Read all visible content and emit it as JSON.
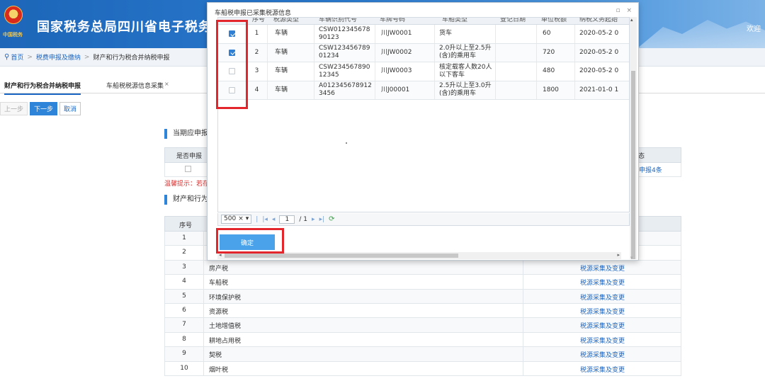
{
  "header": {
    "emblem_caption": "中国税务",
    "site_title": "国家税务总局四川省电子税务局",
    "welcome": "欢迎"
  },
  "breadcrumb": {
    "home": "首页",
    "level1": "税费申报及缴纳",
    "level2": "财产和行为税合并纳税申报",
    "separator": ">"
  },
  "tabs": [
    {
      "label": "财产和行为税合并纳税申报",
      "close": ""
    },
    {
      "label": "车船税税源信息采集",
      "close": "×"
    }
  ],
  "steps": {
    "prev": "上一步",
    "next": "下一步",
    "cancel": "取消"
  },
  "section1": {
    "title": "当期应申报",
    "col_declare": "是否申报",
    "col_status": "态",
    "row_count_link": "未申报4条",
    "tip": "温馨提示：若存"
  },
  "section2": {
    "title": "财产和行为",
    "col_no": "序号",
    "rows": [
      {
        "no": "1",
        "name": "",
        "action": ""
      },
      {
        "no": "2",
        "name": "",
        "action": ""
      },
      {
        "no": "3",
        "name": "房产税",
        "action": "税源采集及变更"
      },
      {
        "no": "4",
        "name": "车船税",
        "action": "税源采集及变更"
      },
      {
        "no": "5",
        "name": "环境保护税",
        "action": "税源采集及变更"
      },
      {
        "no": "6",
        "name": "资源税",
        "action": "税源采集及变更"
      },
      {
        "no": "7",
        "name": "土地增值税",
        "action": "税源采集及变更"
      },
      {
        "no": "8",
        "name": "耕地占用税",
        "action": "税源采集及变更"
      },
      {
        "no": "9",
        "name": "契税",
        "action": "税源采集及变更"
      },
      {
        "no": "10",
        "name": "烟叶税",
        "action": "税源采集及变更"
      }
    ]
  },
  "modal": {
    "title": "车船税申报已采集税源信息",
    "controls": "▫ ×",
    "head_fragments": [
      "序号",
      "税源类型",
      "车辆识别代号",
      "车牌号码",
      "车船类型",
      "登记日期",
      "单位税额",
      "纳税义务起始"
    ],
    "rows": [
      {
        "checked": true,
        "no": "1",
        "type": "车辆",
        "code": "CSW012345678 90123",
        "plate": "川JW0001",
        "kind": "货车",
        "amount": "60",
        "date": "2020-05-2 0"
      },
      {
        "checked": true,
        "no": "2",
        "type": "车辆",
        "code": "CSW123456789 01234",
        "plate": "川JW0002",
        "kind": "2.0升以上至2.5升(含)的乘用车",
        "amount": "720",
        "date": "2020-05-2 0"
      },
      {
        "checked": false,
        "no": "3",
        "type": "车辆",
        "code": "CSW234567890 12345",
        "plate": "川JW0003",
        "kind": "核定载客人数20人以下客车",
        "amount": "480",
        "date": "2020-05-2 0"
      },
      {
        "checked": false,
        "no": "4",
        "type": "车辆",
        "code": "A012345678912 3456",
        "plate": "川J00001",
        "kind": "2.5升以上至3.0升(含)的乘用车",
        "amount": "1800",
        "date": "2021-01-0 1"
      }
    ],
    "pager": {
      "size": "500",
      "page": "1",
      "total": "/ 1"
    },
    "confirm": "确定"
  },
  "colors": {
    "brand": "#1d66b8",
    "accent": "#4aa3ea",
    "highlight": "#e3262c",
    "link": "#1c67c4"
  }
}
